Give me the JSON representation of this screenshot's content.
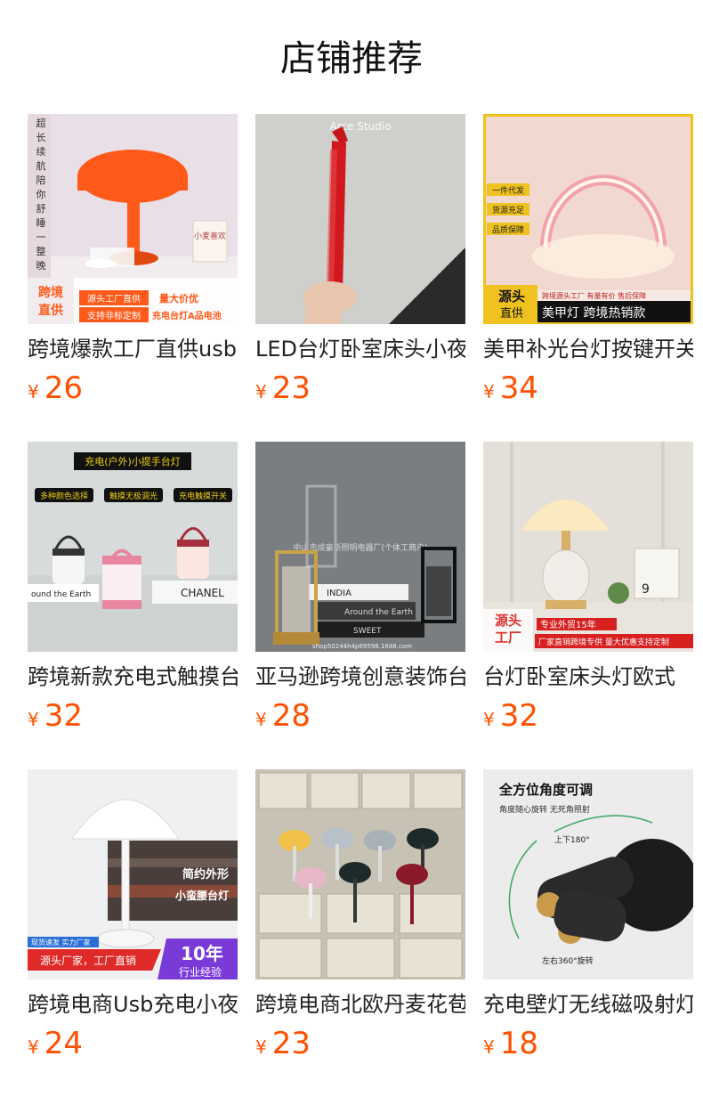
{
  "header": {
    "title": "店铺推荐"
  },
  "products": [
    {
      "title": "跨境爆款工厂直供usb",
      "currency": "¥",
      "price": "26",
      "image": {
        "vertical_text": [
          "超",
          "长",
          "续",
          "航",
          "陪",
          "你",
          "舒",
          "睡",
          "一",
          "整",
          "晚"
        ],
        "badge_left": "跨境直供",
        "line1": "源头工厂直供",
        "line2": "支持非标定制",
        "line3": "量大价优",
        "line4": "充电台灯A品电池",
        "card_text": "小麦喜欢"
      }
    },
    {
      "title": "LED台灯卧室床头小夜灯",
      "currency": "¥",
      "price": "23",
      "image": {
        "watermark": "Arce Studio"
      }
    },
    {
      "title": "美甲补光台灯按键开关",
      "currency": "¥",
      "price": "34",
      "image": {
        "tag1": "一件代发",
        "tag2": "货源充足",
        "tag3": "品质保障",
        "badge": "源头直供",
        "strip_small": "跨境源头工厂 有量有价 售后保障",
        "strip_large": "美甲灯  跨境热销款"
      }
    },
    {
      "title": "跨境新款充电式触摸台灯",
      "currency": "¥",
      "price": "32",
      "image": {
        "headline": "充电(户外)小提手台灯",
        "tag1": "多种颜色选择",
        "tag2": "触摸无极调光",
        "tag3": "充电触摸开关",
        "book_text": "CHANEL",
        "book_text2": "ound the Earth"
      }
    },
    {
      "title": "亚马逊跨境创意装饰台灯",
      "currency": "¥",
      "price": "28",
      "image": {
        "watermark": "中山市成豪斯照明电器厂(个体工商户)",
        "watermark2": "shop50244h4p69598.1688.com",
        "book1": "INDIA",
        "book2": "Around the Earth",
        "book3": "SWEET"
      }
    },
    {
      "title": "台灯卧室床头灯欧式",
      "currency": "¥",
      "price": "32",
      "image": {
        "badge": "源头工厂",
        "line1": "专业外贸15年",
        "line2": "厂家直销跨境专供 量大优惠支持定制",
        "calendar_num": "9"
      }
    },
    {
      "title": "跨境电商Usb充电小夜灯",
      "currency": "¥",
      "price": "24",
      "image": {
        "text1": "简约外形",
        "text2": "小蛮腰台灯",
        "tag_small": "现货速发 实力厂家",
        "ribbon": "源头厂家，工厂直销",
        "badge_num": "10年",
        "badge_sub": "行业经验"
      }
    },
    {
      "title": "跨境电商北欧丹麦花苞",
      "currency": "¥",
      "price": "23",
      "image": {}
    },
    {
      "title": "充电壁灯无线磁吸射灯",
      "currency": "¥",
      "price": "18",
      "image": {
        "headline": "全方位角度可调",
        "sub": "角度随心旋转 无死角照射",
        "up": "上下180°",
        "left": "左右360°旋转"
      }
    }
  ]
}
